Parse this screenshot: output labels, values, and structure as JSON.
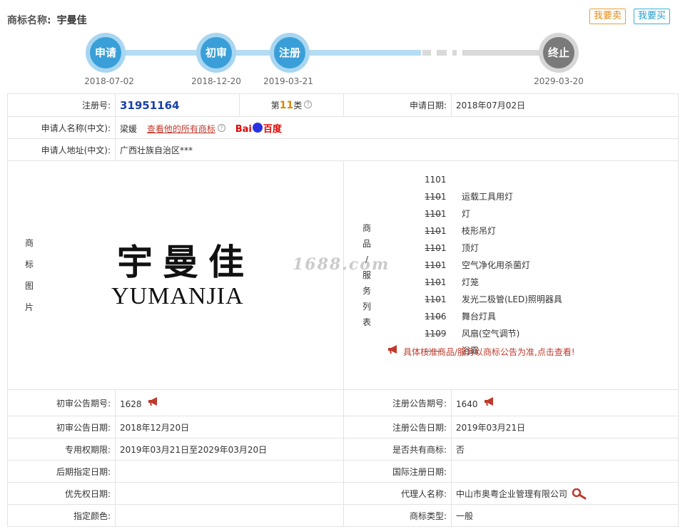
{
  "header": {
    "title_label": "商标名称:",
    "trademark_name": "宇曼佳",
    "sell_button": "我要卖",
    "buy_button": "我要买"
  },
  "timeline": [
    {
      "label": "申请",
      "date": "2018-07-02",
      "state": "done"
    },
    {
      "label": "初审",
      "date": "2018-12-20",
      "state": "done"
    },
    {
      "label": "注册",
      "date": "2019-03-21",
      "state": "done"
    },
    {
      "label": "终止",
      "date": "2029-03-20",
      "state": "pending"
    }
  ],
  "details": {
    "reg_no_label": "注册号:",
    "reg_no": "31951164",
    "class_prefix": "第",
    "class_num": "11",
    "class_suffix": "类",
    "apply_date_label": "申请日期:",
    "apply_date": "2018年07月02日",
    "applicant_label": "申请人名称(中文):",
    "applicant": "梁媛",
    "view_all_link": "查看他的所有商标",
    "baidu_left": "Bai",
    "baidu_right": "百度",
    "address_label": "申请人地址(中文):",
    "address": "广西壮族自治区***",
    "image_label": [
      "商",
      "标",
      "图",
      "片"
    ],
    "logo_cn": "宇曼佳",
    "logo_en": "YUMANJIA",
    "watermark": "1688.com",
    "goods_label": [
      "商",
      "品",
      "/",
      "服",
      "务",
      "列",
      "表"
    ],
    "goods": [
      {
        "code": "1101——",
        "name": "运载工具用灯"
      },
      {
        "code": "1101——",
        "name": "灯"
      },
      {
        "code": "1101——",
        "name": "枝形吊灯"
      },
      {
        "code": "1101——",
        "name": "顶灯"
      },
      {
        "code": "1101——",
        "name": "空气净化用杀菌灯"
      },
      {
        "code": "1101——",
        "name": "灯笼"
      },
      {
        "code": "1101——",
        "name": "发光二极管(LED)照明器具"
      },
      {
        "code": "1101——",
        "name": "舞台灯具"
      },
      {
        "code": "1106——",
        "name": "风扇(空气调节)"
      },
      {
        "code": "1109——",
        "name": "浴霸"
      }
    ],
    "goods_notice": "具体核准商品/服务以商标公告为准,点击查看!",
    "prelim_no_label": "初审公告期号:",
    "prelim_no": "1628",
    "reg_pub_no_label": "注册公告期号:",
    "reg_pub_no": "1640",
    "prelim_date_label": "初审公告日期:",
    "prelim_date": "2018年12月20日",
    "reg_pub_date_label": "注册公告日期:",
    "reg_pub_date": "2019年03月21日",
    "exclusive_label": "专用权期限:",
    "exclusive": "2019年03月21日至2029年03月20日",
    "shared_label": "是否共有商标:",
    "shared": "否",
    "later_label": "后期指定日期:",
    "later": "",
    "intl_label": "国际注册日期:",
    "intl": "",
    "priority_label": "优先权日期:",
    "priority": "",
    "agent_label": "代理人名称:",
    "agent": "中山市奥粤企业管理有限公司",
    "color_label": "指定颜色:",
    "color": "",
    "type_label": "商标类型:",
    "type": "一般"
  },
  "colors": {
    "accent_blue": "#3a9fd8",
    "track_blue": "#b4dcf2",
    "pending_grey": "#7a7a7a",
    "reg_no": "#1a3faa",
    "class_num": "#d88a00",
    "notice_red": "#c0392b"
  }
}
